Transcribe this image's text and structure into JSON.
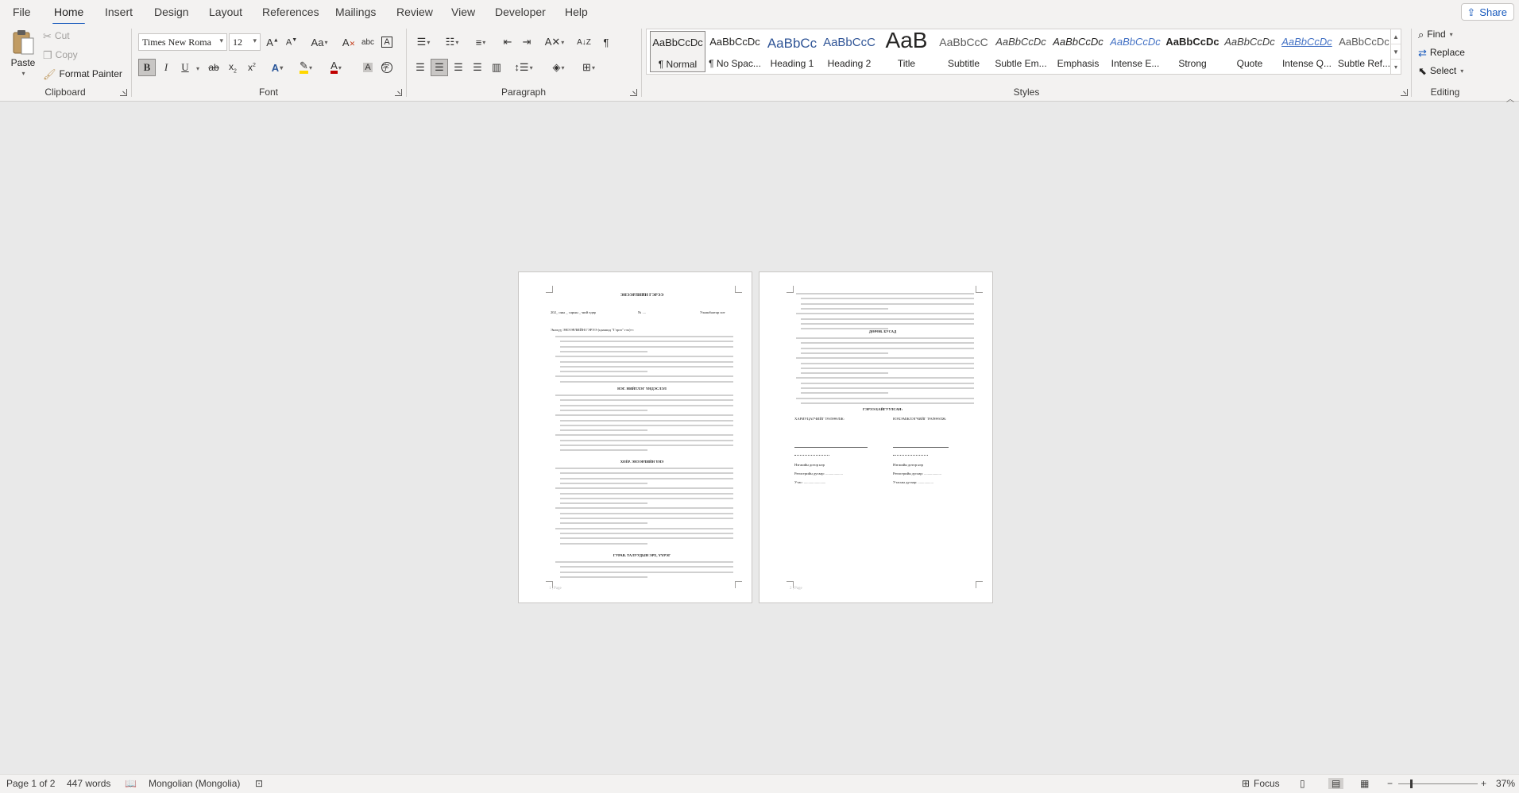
{
  "tabs": [
    "File",
    "Home",
    "Insert",
    "Design",
    "Layout",
    "References",
    "Mailings",
    "Review",
    "View",
    "Developer",
    "Help"
  ],
  "share_label": "Share",
  "clipboard": {
    "paste": "Paste",
    "cut": "Cut",
    "copy": "Copy",
    "format_painter": "Format Painter",
    "label": "Clipboard"
  },
  "font": {
    "family": "Times New Roma",
    "size": "12",
    "label": "Font",
    "case": "Aa"
  },
  "paragraph": {
    "label": "Paragraph"
  },
  "styles": {
    "label": "Styles",
    "items": [
      {
        "preview": "AaBbCcDc",
        "name": "¶ Normal"
      },
      {
        "preview": "AaBbCcDc",
        "name": "¶ No Spac..."
      },
      {
        "preview": "AaBbCc",
        "name": "Heading 1"
      },
      {
        "preview": "AaBbCcC",
        "name": "Heading 2"
      },
      {
        "preview": "AaB",
        "name": "Title"
      },
      {
        "preview": "AaBbCcC",
        "name": "Subtitle"
      },
      {
        "preview": "AaBbCcDc",
        "name": "Subtle Em..."
      },
      {
        "preview": "AaBbCcDc",
        "name": "Emphasis"
      },
      {
        "preview": "AaBbCcDc",
        "name": "Intense E..."
      },
      {
        "preview": "AaBbCcDc",
        "name": "Strong"
      },
      {
        "preview": "AaBbCcDc",
        "name": "Quote"
      },
      {
        "preview": "AaBbCcDc",
        "name": "Intense Q..."
      },
      {
        "preview": "AaBbCcDc",
        "name": "Subtle Ref..."
      }
    ]
  },
  "editing": {
    "find": "Find",
    "replace": "Replace",
    "select": "Select",
    "label": "Editing"
  },
  "page1": {
    "title": "ЭНЭЭРЛИЙН ГЭРЭЭ",
    "dateline": "202_ оны _ сарын _-ний өдөр",
    "no": "№ ....",
    "city": "Улаанбаатар хот",
    "intro": "Энэхүү ЭНЭЭРЛИЙН ГЭРЭЭ (цаашид \"Гэрээ\" гэх)-г:",
    "s1": "НЭГ. НИЙТЛЭГ ҮНДЭСЛЭЛ",
    "s2": "ХОЁР. ЭНЭЭРЛИЙН ҮНЭ",
    "s3": "ГУРАВ. ТАЛУУДЫН ЭРХ, ҮҮРЭГ",
    "footer": "1 | Page"
  },
  "page2": {
    "s4": "ДӨРӨВ. БУСАД",
    "s5": "ГЭРЭЭ БАЙГУУЛСАН:",
    "left_party": "ХАРИУЦАГЧИЙГ ТӨЛӨӨЛЖ:",
    "right_party": "НЭХЭМЖЛЭГЧИЙГ ТӨЛӨӨЛЖ:",
    "sign1": "Нэгжийн дотор нэр",
    "sign2": "Регистрийн дугаар: ...................",
    "sign3": "Утас: ........................",
    "sign4": "Утасны дугаар: .................",
    "footer": "2 | Page"
  },
  "status": {
    "page": "Page 1 of 2",
    "words": "447 words",
    "language": "Mongolian (Mongolia)",
    "focus": "Focus",
    "zoom": "37%"
  }
}
